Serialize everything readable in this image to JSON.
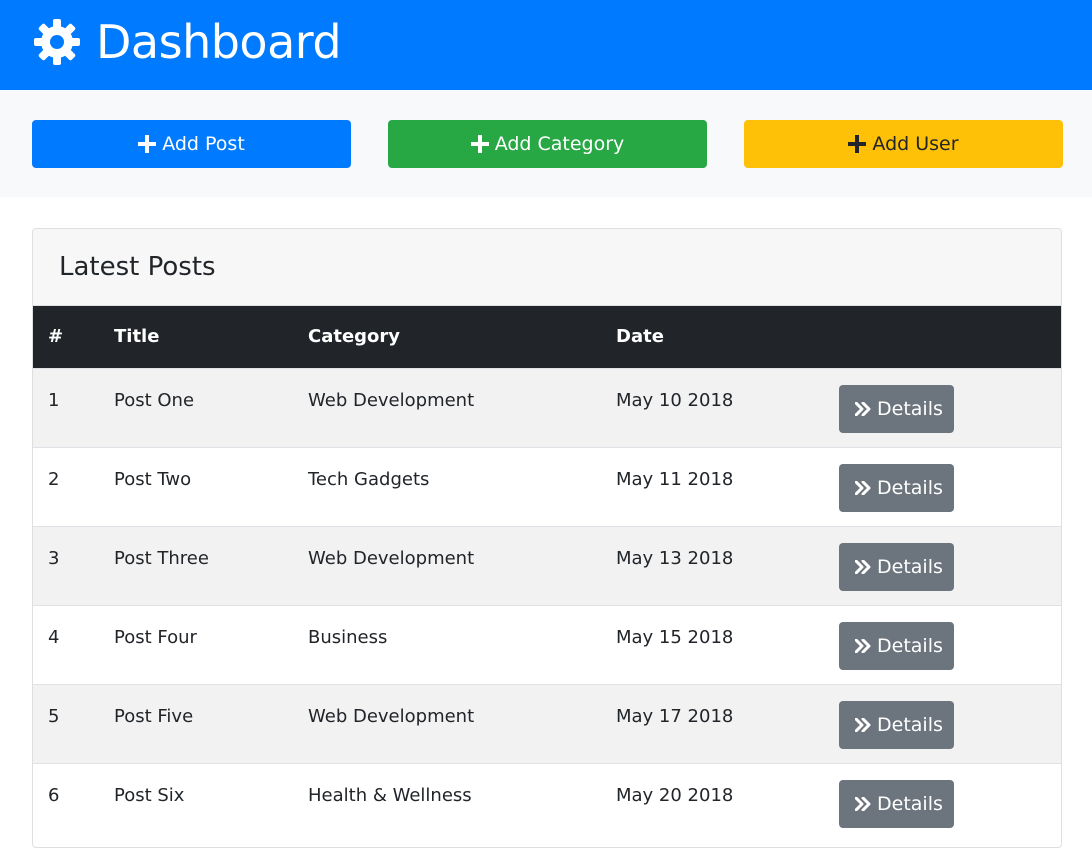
{
  "header": {
    "title": "Dashboard",
    "icon": "gear-icon"
  },
  "actions": {
    "add_post": "Add Post",
    "add_category": "Add Category",
    "add_user": "Add User"
  },
  "posts": {
    "title": "Latest Posts",
    "columns": [
      "#",
      "Title",
      "Category",
      "Date",
      ""
    ],
    "rows": [
      {
        "num": "1",
        "title": "Post One",
        "category": "Web Development",
        "date": "May 10 2018",
        "action": "Details"
      },
      {
        "num": "2",
        "title": "Post Two",
        "category": "Tech Gadgets",
        "date": "May 11 2018",
        "action": "Details"
      },
      {
        "num": "3",
        "title": "Post Three",
        "category": "Web Development",
        "date": "May 13 2018",
        "action": "Details"
      },
      {
        "num": "4",
        "title": "Post Four",
        "category": "Business",
        "date": "May 15 2018",
        "action": "Details"
      },
      {
        "num": "5",
        "title": "Post Five",
        "category": "Web Development",
        "date": "May 17 2018",
        "action": "Details"
      },
      {
        "num": "6",
        "title": "Post Six",
        "category": "Health & Wellness",
        "date": "May 20 2018",
        "action": "Details"
      }
    ]
  },
  "colors": {
    "primary": "#007bff",
    "success": "#28a745",
    "warning": "#ffc107",
    "secondary": "#6c757d",
    "dark": "#212529"
  }
}
